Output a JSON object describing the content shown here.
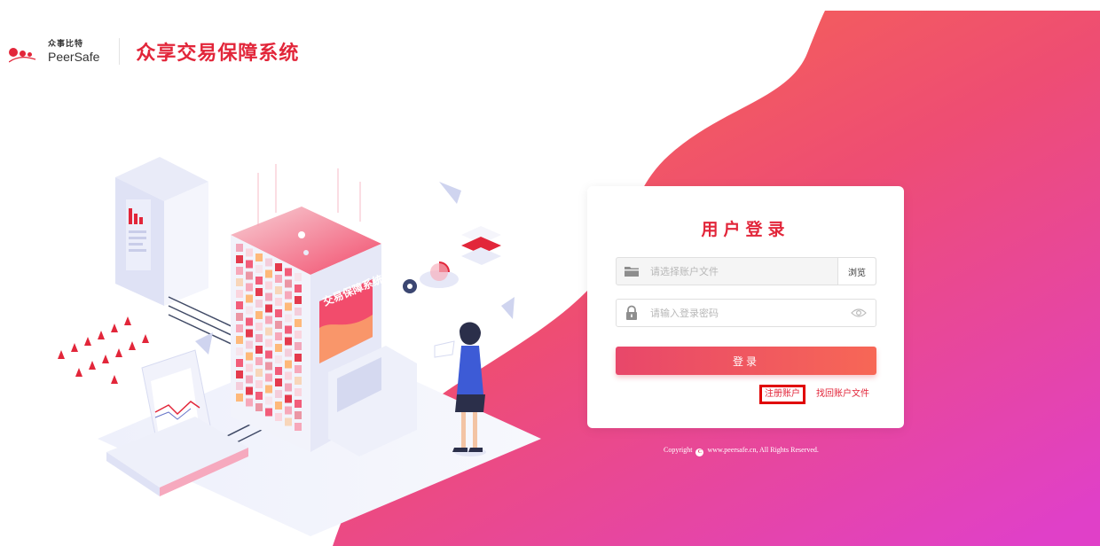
{
  "header": {
    "logo_cn": "众事比特",
    "logo_en": "PeerSafe",
    "app_title": "众享交易保障系统"
  },
  "illustration": {
    "machine_label": "交易保障系统"
  },
  "login": {
    "title": "用户登录",
    "file_placeholder": "请选择账户文件",
    "browse_label": "浏览",
    "password_placeholder": "请输入登录密码",
    "submit_label": "登录",
    "register_label": "注册账户",
    "recover_label": "找回账户文件"
  },
  "footer": {
    "copyright_prefix": "Copyright",
    "copyright_symbol": "C",
    "copyright_suffix": "www.peersafe.cn, All Rights Reserved."
  },
  "colors": {
    "brand_red": "#e2263a",
    "gradient_start": "#f7674f",
    "gradient_end": "#e040c8",
    "highlight_box": "#e00000"
  },
  "icons": [
    "folder-icon",
    "lock-icon",
    "eye-icon",
    "copyright-icon",
    "gear-icon",
    "pie-chart-icon",
    "bar-chart-icon"
  ]
}
